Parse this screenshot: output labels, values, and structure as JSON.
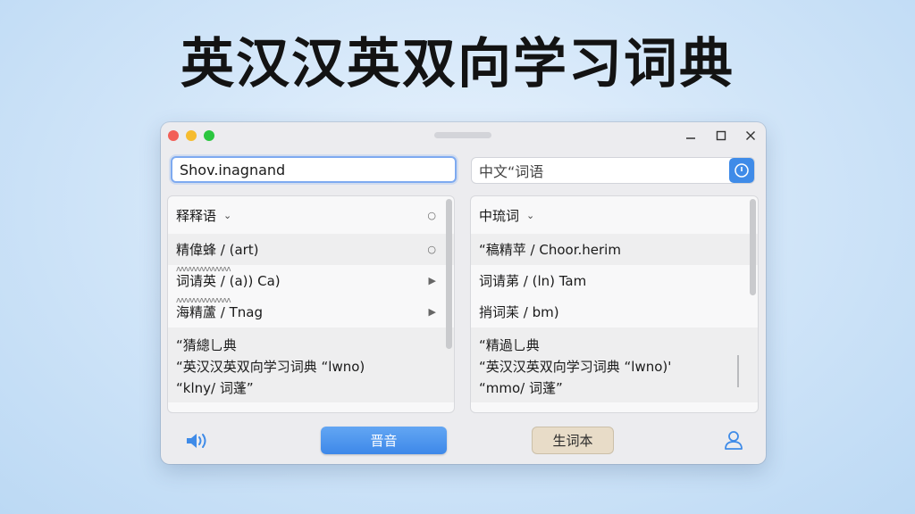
{
  "hero": {
    "title": "英汉汉英双向学习词典"
  },
  "search": {
    "left_value": "Shov.inagnand",
    "right_value": "中文“词语"
  },
  "left_panel": {
    "header": "释释语",
    "rows": [
      {
        "text": "精偉蜂 / (art)"
      },
      {
        "text": "词请英 / (a)) Ca)"
      },
      {
        "text": "海精蘆 / Tnag"
      }
    ],
    "example_lines": [
      "“猜總乚典",
      "“英汉汉英双向学习词典 “lwno)",
      " “klny/ 词蓬”"
    ]
  },
  "right_panel": {
    "header": "中琉词",
    "rows": [
      {
        "text": "“稿精苹 / Choor.herim"
      },
      {
        "text": "词请苐 / (ln) Tam"
      },
      {
        "text": "捎词苿 / bm)"
      }
    ],
    "example_lines": [
      "“精過乚典",
      "“英汉汉英双向学习词典 “lwno)'",
      " “mmo/ 词蓬”"
    ]
  },
  "bottom": {
    "primary_button": "晋音",
    "secondary_button": "生词本"
  },
  "colors": {
    "accent": "#3f8be8",
    "secondary_button_bg": "#e8dcc8",
    "traffic_red": "#f25f57",
    "traffic_yellow": "#f6bc2f",
    "traffic_green": "#2bc63f"
  },
  "icons": {
    "go": "compass-icon",
    "speaker": "speaker-icon",
    "user": "user-icon",
    "minimize": "minimize-icon",
    "maximize": "maximize-icon",
    "close": "close-icon"
  }
}
